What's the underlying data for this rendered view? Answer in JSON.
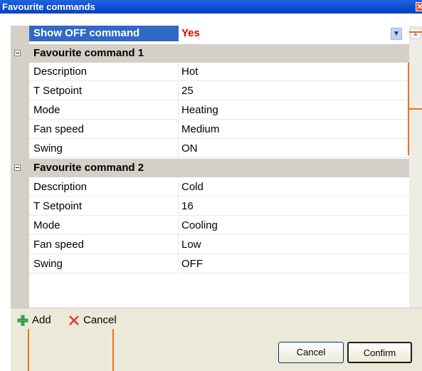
{
  "window": {
    "title": "Favourite commands",
    "close_glyph": "✕"
  },
  "show_off": {
    "label": "Show OFF command",
    "value": "Yes"
  },
  "categories": [
    {
      "title": "Favourite command 1",
      "rows": [
        {
          "name": "Description",
          "value": "Hot"
        },
        {
          "name": "T Setpoint",
          "value": "25"
        },
        {
          "name": "Mode",
          "value": "Heating"
        },
        {
          "name": "Fan speed",
          "value": "Medium"
        },
        {
          "name": "Swing",
          "value": "ON"
        }
      ]
    },
    {
      "title": "Favourite command 2",
      "rows": [
        {
          "name": "Description",
          "value": "Cold"
        },
        {
          "name": "T Setpoint",
          "value": "16"
        },
        {
          "name": "Mode",
          "value": "Cooling"
        },
        {
          "name": "Fan speed",
          "value": "Low"
        },
        {
          "name": "Swing",
          "value": "OFF"
        }
      ]
    }
  ],
  "toolbar": {
    "add_label": "Add",
    "cancel_label": "Cancel"
  },
  "footer": {
    "cancel_label": "Cancel",
    "confirm_label": "Confirm"
  },
  "colors": {
    "accent": "#316ac5",
    "title_bar": "#0a4bd0",
    "value_highlight": "#e00000",
    "callout": "#e8731f"
  }
}
